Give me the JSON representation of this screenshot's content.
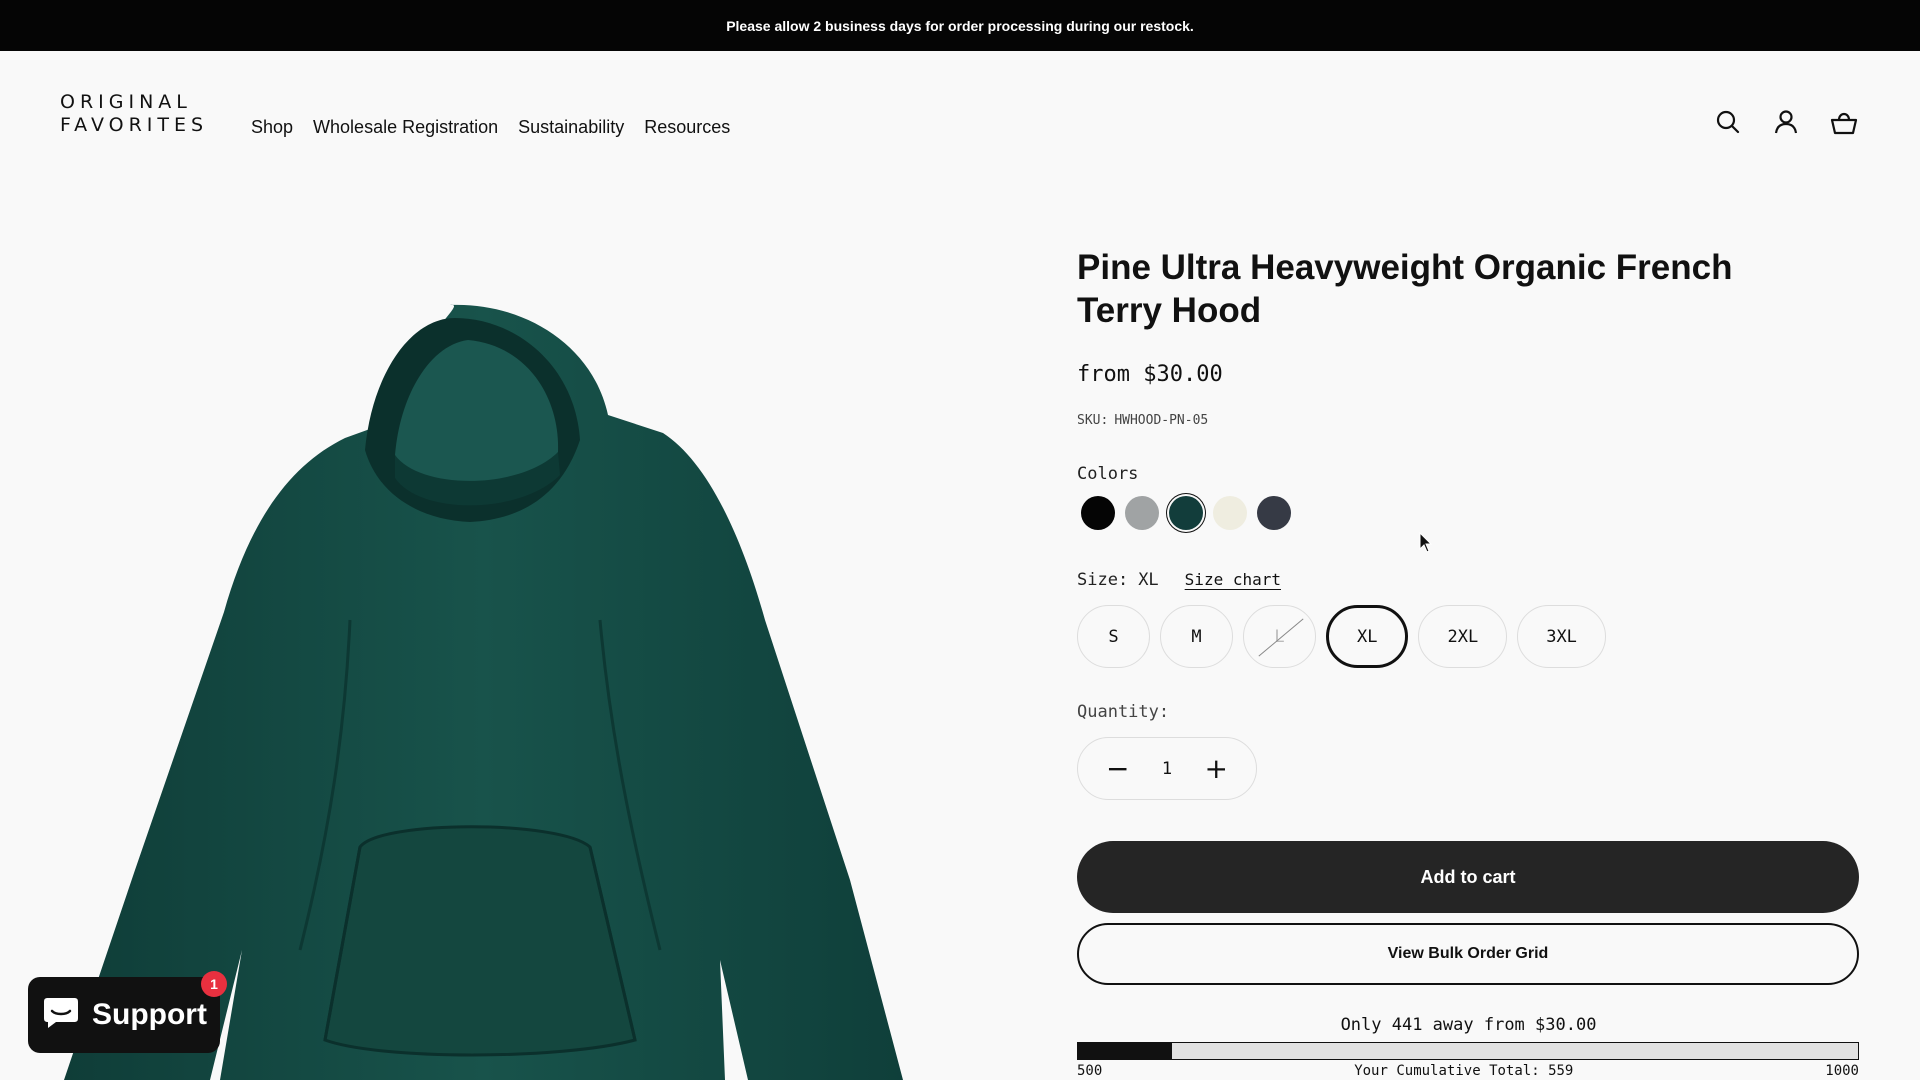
{
  "announcement": "Please allow 2 business days for order processing during our restock.",
  "header": {
    "logo_line1": "ORIGINAL",
    "logo_line2": "FAVORITES",
    "nav": [
      "Shop",
      "Wholesale Registration",
      "Sustainability",
      "Resources"
    ],
    "icons": [
      "search-icon",
      "account-icon",
      "cart-icon"
    ]
  },
  "product": {
    "title": "Pine Ultra Heavyweight Organic French Terry Hood",
    "price": "from $30.00",
    "sku_label": "SKU:",
    "sku": "HWHOOD-PN-05",
    "colors_label": "Colors",
    "colors": [
      {
        "name": "black",
        "hex": "#050505"
      },
      {
        "name": "heather-grey",
        "hex": "#a0a3a4"
      },
      {
        "name": "pine",
        "hex": "#123d3b"
      },
      {
        "name": "cream",
        "hex": "#efede0"
      },
      {
        "name": "charcoal",
        "hex": "#363a45"
      }
    ],
    "selected_color_index": 2,
    "size_label": "Size:",
    "size_selected": "XL",
    "size_chart_label": "Size chart",
    "sizes": [
      {
        "label": "S",
        "state": "available"
      },
      {
        "label": "M",
        "state": "available"
      },
      {
        "label": "L",
        "state": "disabled"
      },
      {
        "label": "XL",
        "state": "selected"
      },
      {
        "label": "2XL",
        "state": "available"
      },
      {
        "label": "3XL",
        "state": "available"
      }
    ],
    "quantity_label": "Quantity:",
    "quantity": "1",
    "add_to_cart": "Add to cart",
    "bulk_order": "View Bulk Order Grid",
    "threshold_text": "Only 441 away from $30.00",
    "progress_fraction": 0.12,
    "progress_min": "500",
    "progress_mid": "Your Cumulative Total: 559",
    "progress_max": "1000"
  },
  "support": {
    "label": "Support",
    "badge": "1"
  },
  "colors": {
    "announcement_bg": "#050505",
    "page_bg": "#f9f9f9",
    "button_dark": "#252525",
    "hoodie_green": "#164b45",
    "badge_red": "#e8303f"
  }
}
